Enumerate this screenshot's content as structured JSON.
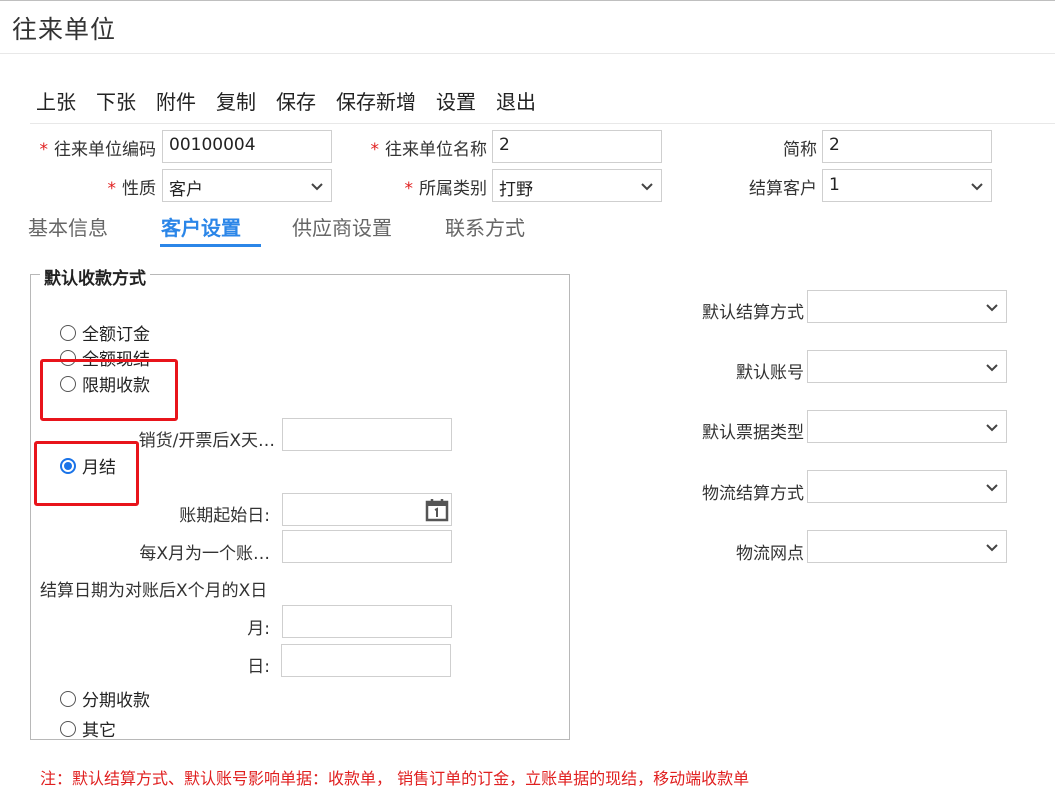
{
  "title": "往来单位",
  "toolbar": [
    "上张",
    "下张",
    "附件",
    "复制",
    "保存",
    "保存新增",
    "设置",
    "退出"
  ],
  "header_fields": {
    "code_label": "往来单位编码",
    "code_value": "00100004",
    "name_label": "往来单位名称",
    "name_value": "2",
    "short_label": "简称",
    "short_value": "2",
    "nature_label": "性质",
    "nature_value": "客户",
    "category_label": "所属类别",
    "category_value": "打野",
    "settle_customer_label": "结算客户",
    "settle_customer_value": "1",
    "required_mark": "*"
  },
  "tabs": [
    "基本信息",
    "客户设置",
    "供应商设置",
    "联系方式"
  ],
  "active_tab": "客户设置",
  "collection": {
    "legend": "默认收款方式",
    "options": [
      "全额订金",
      "全额现结",
      "限期收款",
      "月结",
      "分期收款",
      "其它"
    ],
    "selected": "月结",
    "days_after_label": "销货/开票后X天…",
    "days_after_value": "",
    "period_start_label": "账期起始日:",
    "period_start_value": "",
    "every_x_months_label": "每X月为一个账…",
    "every_x_months_value": "",
    "settle_date_label": "结算日期为对账后X个月的X日",
    "month_label": "月:",
    "month_value": "",
    "day_label": "日:",
    "day_value": ""
  },
  "right_fields": {
    "settle_method_label": "默认结算方式",
    "settle_method_value": "",
    "account_label": "默认账号",
    "account_value": "",
    "bill_type_label": "默认票据类型",
    "bill_type_value": "",
    "logistics_settle_label": "物流结算方式",
    "logistics_settle_value": "",
    "logistics_point_label": "物流网点",
    "logistics_point_value": ""
  },
  "note": "注：默认结算方式、默认账号影响单据：收款单， 销售订单的订金，立账单据的现结，移动端收款单",
  "colors": {
    "accent": "#2b86e8",
    "required": "#e02020",
    "highlight_box": "#e8141b",
    "radio_selected": "#1a73e8"
  }
}
